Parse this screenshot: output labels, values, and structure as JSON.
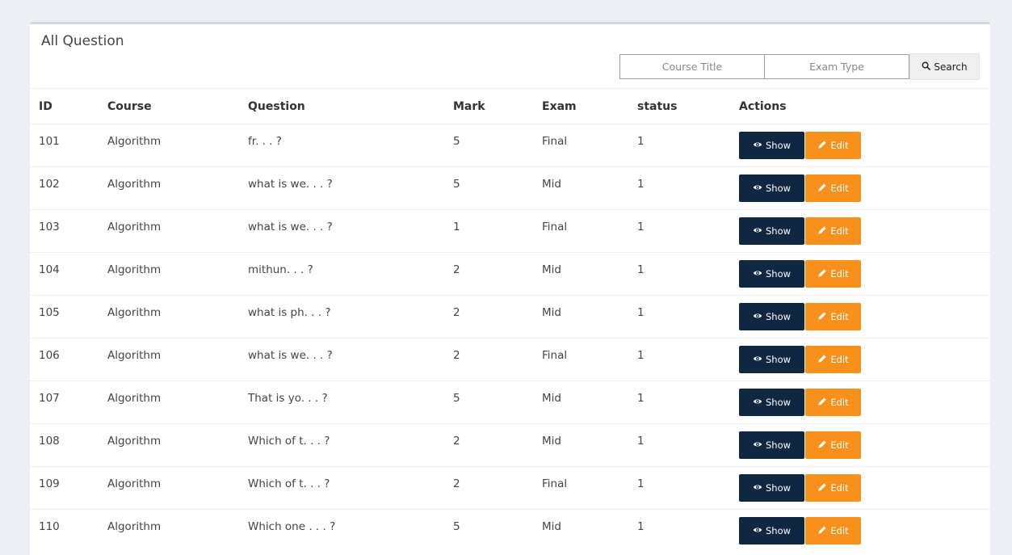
{
  "panel": {
    "title": "All Question"
  },
  "search": {
    "course_placeholder": "Course Title",
    "exam_placeholder": "Exam Type",
    "button_label": "Search"
  },
  "table": {
    "headers": [
      "ID",
      "Course",
      "Question",
      "Mark",
      "Exam",
      "status",
      "Actions"
    ],
    "show_label": "Show",
    "edit_label": "Edit",
    "rows": [
      {
        "id": "101",
        "course": "Algorithm",
        "question": "fr. . . ?",
        "mark": "5",
        "exam": "Final",
        "status": "1"
      },
      {
        "id": "102",
        "course": "Algorithm",
        "question": "what is we. . . ?",
        "mark": "5",
        "exam": "Mid",
        "status": "1"
      },
      {
        "id": "103",
        "course": "Algorithm",
        "question": "what is we. . . ?",
        "mark": "1",
        "exam": "Final",
        "status": "1"
      },
      {
        "id": "104",
        "course": "Algorithm",
        "question": "mithun. . . ?",
        "mark": "2",
        "exam": "Mid",
        "status": "1"
      },
      {
        "id": "105",
        "course": "Algorithm",
        "question": "what is ph. . . ?",
        "mark": "2",
        "exam": "Mid",
        "status": "1"
      },
      {
        "id": "106",
        "course": "Algorithm",
        "question": "what is we. . . ?",
        "mark": "2",
        "exam": "Final",
        "status": "1"
      },
      {
        "id": "107",
        "course": "Algorithm",
        "question": "That is yo. . . ?",
        "mark": "5",
        "exam": "Mid",
        "status": "1"
      },
      {
        "id": "108",
        "course": "Algorithm",
        "question": "Which of t. . . ?",
        "mark": "2",
        "exam": "Mid",
        "status": "1"
      },
      {
        "id": "109",
        "course": "Algorithm",
        "question": "Which of t. . . ?",
        "mark": "2",
        "exam": "Final",
        "status": "1"
      },
      {
        "id": "110",
        "course": "Algorithm",
        "question": "Which one . . . ?",
        "mark": "5",
        "exam": "Mid",
        "status": "1"
      }
    ]
  },
  "colors": {
    "show_button": "#0f2740",
    "edit_button": "#f7911c",
    "page_background": "#ecf0f5"
  },
  "icons": {
    "search": "search-icon",
    "show": "eye-icon",
    "edit": "pencil-icon"
  }
}
